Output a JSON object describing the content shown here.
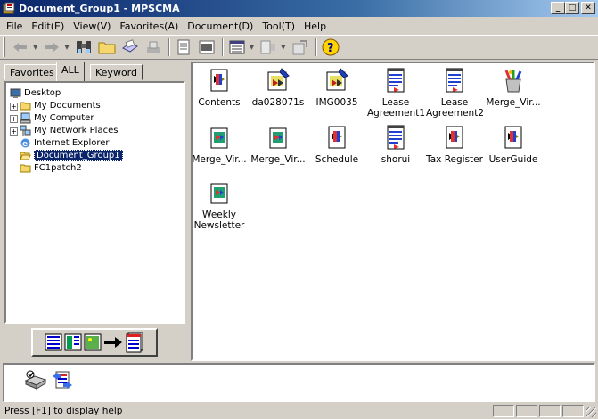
{
  "window": {
    "title": "Document_Group1 - MPSCMA",
    "min_label": "_",
    "max_label": "□",
    "close_label": "✕"
  },
  "menu": [
    {
      "label": "File",
      "key": "F"
    },
    {
      "label": "Edit(E)",
      "key": "E"
    },
    {
      "label": "View(V)",
      "key": "V"
    },
    {
      "label": "Favorites(A)",
      "key": "A"
    },
    {
      "label": "Document(D)",
      "key": "D"
    },
    {
      "label": "Tool(T)",
      "key": "T"
    },
    {
      "label": "Help",
      "key": "H"
    }
  ],
  "menu_display": [
    "File",
    "Edit(E)",
    "View(V)",
    "Favorites(A)",
    "Document(D)",
    "Tool(T)",
    "Help"
  ],
  "tabs": {
    "favorites": "Favorites",
    "all": "ALL",
    "keyword": "Keyword"
  },
  "tree": {
    "desktop": "Desktop",
    "my_documents": "My Documents",
    "my_computer": "My Computer",
    "my_network_places": "My Network Places",
    "internet_explorer": "Internet Explorer",
    "document_group1": "Document_Group1",
    "fc1patch2": "FC1patch2"
  },
  "files": [
    {
      "label1": "Contents",
      "label2": "",
      "icon": "doc-icon"
    },
    {
      "label1": "da028071s",
      "label2": "",
      "icon": "image-doc-icon"
    },
    {
      "label1": "IMG0035",
      "label2": "",
      "icon": "image-doc-icon"
    },
    {
      "label1": "Lease",
      "label2": "Agreement1",
      "icon": "text-doc-icon"
    },
    {
      "label1": "Lease",
      "label2": "Agreement2",
      "icon": "text-doc-icon"
    },
    {
      "label1": "Merge_Vir...",
      "label2": "",
      "icon": "tools-icon"
    },
    {
      "label1": "Merge_Vir...",
      "label2": "",
      "icon": "picture-doc-icon"
    },
    {
      "label1": "Merge_Vir...",
      "label2": "",
      "icon": "picture-doc-icon"
    },
    {
      "label1": "Schedule",
      "label2": "",
      "icon": "doc-icon"
    },
    {
      "label1": "shorui",
      "label2": "",
      "icon": "text-doc-icon"
    },
    {
      "label1": "Tax Register",
      "label2": "",
      "icon": "doc-icon"
    },
    {
      "label1": "UserGuide",
      "label2": "",
      "icon": "doc-icon"
    },
    {
      "label1": "Weekly",
      "label2": "Newsletter",
      "icon": "picture-doc-icon"
    }
  ],
  "status": {
    "text": "Press [F1] to display help"
  }
}
